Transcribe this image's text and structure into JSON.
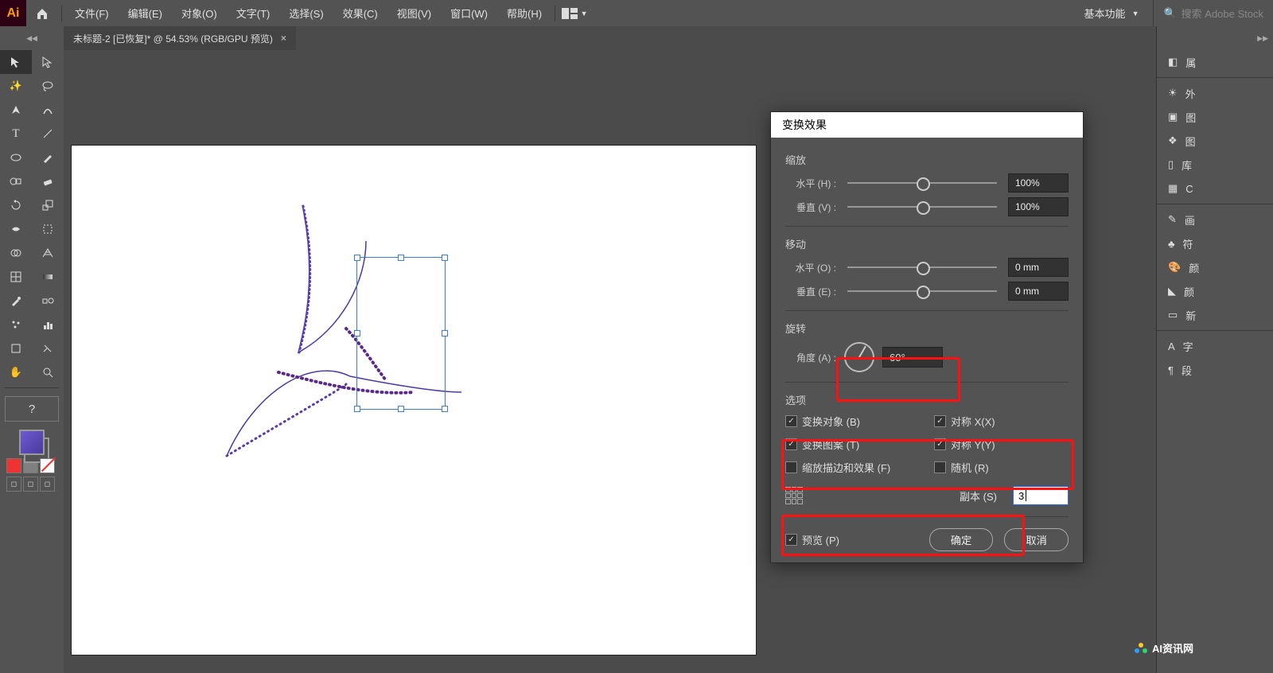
{
  "menubar": {
    "app_logo": "Ai",
    "items": [
      "文件(F)",
      "编辑(E)",
      "对象(O)",
      "文字(T)",
      "选择(S)",
      "效果(C)",
      "视图(V)",
      "窗口(W)",
      "帮助(H)"
    ],
    "workspace": "基本功能",
    "search_placeholder": "搜索 Adobe Stock"
  },
  "tabs": {
    "document": "未标题-2 [已恢复]* @ 54.53% (RGB/GPU 预览)"
  },
  "right_dock": {
    "items": [
      "属",
      "外",
      "图",
      "图",
      "库",
      "C",
      "画",
      "符",
      "颜",
      "颜",
      "新",
      "字",
      "段"
    ]
  },
  "dialog": {
    "title": "变换效果",
    "scale": {
      "section": "缩放",
      "h_label": "水平 (H) :",
      "h_value": "100%",
      "v_label": "垂直 (V) :",
      "v_value": "100%"
    },
    "move": {
      "section": "移动",
      "h_label": "水平 (O) :",
      "h_value": "0 mm",
      "v_label": "垂直 (E) :",
      "v_value": "0 mm"
    },
    "rotate": {
      "section": "旋转",
      "label": "角度 (A) :",
      "value": "60°"
    },
    "options": {
      "section": "选项",
      "transform_obj": "变换对象 (B)",
      "reflect_x": "对称 X(X)",
      "transform_pat": "变换图案 (T)",
      "reflect_y": "对称 Y(Y)",
      "scale_strokes": "缩放描边和效果 (F)",
      "random": "随机 (R)"
    },
    "copies": {
      "label": "副本 (S)",
      "value": "3"
    },
    "preview": "预览 (P)",
    "ok": "确定",
    "cancel": "取消"
  },
  "watermark": "AI资讯网"
}
